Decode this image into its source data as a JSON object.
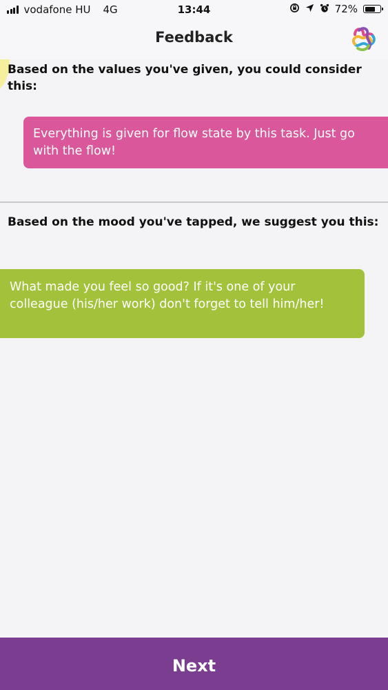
{
  "status_bar": {
    "carrier": "vodafone HU",
    "network": "4G",
    "time": "13:44",
    "battery_percent": "72%",
    "battery_level": 0.72,
    "icons": [
      "rotation-lock-icon",
      "location-arrow-icon",
      "alarm-icon",
      "battery-icon"
    ]
  },
  "header": {
    "title": "Feedback",
    "logo_icon": "colorful-knot-logo-icon"
  },
  "value_feedback": {
    "label": "Based on the values you've given, you could consider this:",
    "message": "Everything is given for flow state by this task. Just go with the flow!",
    "color": "#d9579a"
  },
  "mood_feedback": {
    "label": "Based on the mood you've tapped, we suggest you this:",
    "message": "What made you feel so good? If it's one of your colleague (his/her work) don't forget to tell him/her!",
    "color": "#a3c23b"
  },
  "footer": {
    "next_label": "Next",
    "color": "#7a3d8f"
  }
}
